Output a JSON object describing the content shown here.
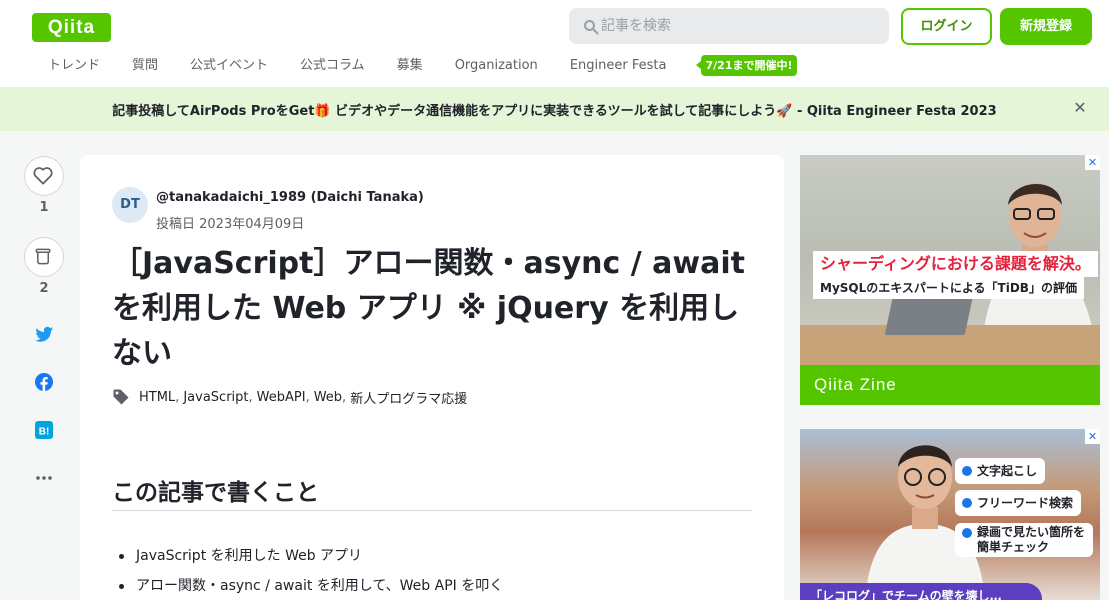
{
  "header": {
    "logo": "Qiita",
    "search_placeholder": "記事を検索",
    "login_label": "ログイン",
    "signup_label": "新規登録"
  },
  "nav": {
    "items": [
      "トレンド",
      "質問",
      "公式イベント",
      "公式コラム",
      "募集",
      "Organization",
      "Engineer Festa"
    ],
    "festa_badge": "7/21まで開催中!"
  },
  "banner": {
    "text": "記事投稿してAirPods ProをGet🎁 ビデオやデータ通信機能をアプリに実装できるツールを試して記事にしよう🚀 - Qiita Engineer Festa 2023",
    "close_label": "✕"
  },
  "actions": {
    "like_count": "1",
    "stock_count": "2"
  },
  "article": {
    "avatar_initials": "DT",
    "author": "@tanakadaichi_1989 (Daichi Tanaka)",
    "posted": "投稿日 2023年04月09日",
    "title": "［JavaScript］アロー関数・async / await を利用した Web アプリ ※ jQuery を利用しない",
    "tags": [
      "HTML",
      "JavaScript",
      "WebAPI",
      "Web",
      "新人プログラマ応援"
    ],
    "tag_separator": ",",
    "section_heading": "この記事で書くこと",
    "bullets": [
      "JavaScript を利用した Web アプリ",
      "アロー関数・async / await を利用して、Web API を叩く"
    ]
  },
  "ads": {
    "ad1": {
      "headline": "シャーディングにおける課題を解決。",
      "sub": "MySQLのエキスパートによる「TiDB」の評価",
      "brand": "Qiita Zine",
      "close": "✕"
    },
    "ad2": {
      "chips": [
        "文字起こし",
        "フリーワード検索",
        "録画で見たい箇所を",
        "簡単チェック"
      ],
      "tail": "「レコログ」でチームの壁を壊し…",
      "close": "✕"
    }
  },
  "colors": {
    "brand_green": "#55c500",
    "banner_bg": "#e4f5d8",
    "ad_red": "#e5223b",
    "twitter_blue": "#1d9bf0",
    "facebook_blue": "#1877f2",
    "hatena_blue": "#00a4de"
  },
  "icons": [
    "search-icon",
    "heart-icon",
    "stock-icon",
    "twitter-icon",
    "facebook-icon",
    "hatena-bookmark-icon",
    "more-icon",
    "tag-icon",
    "close-icon"
  ]
}
